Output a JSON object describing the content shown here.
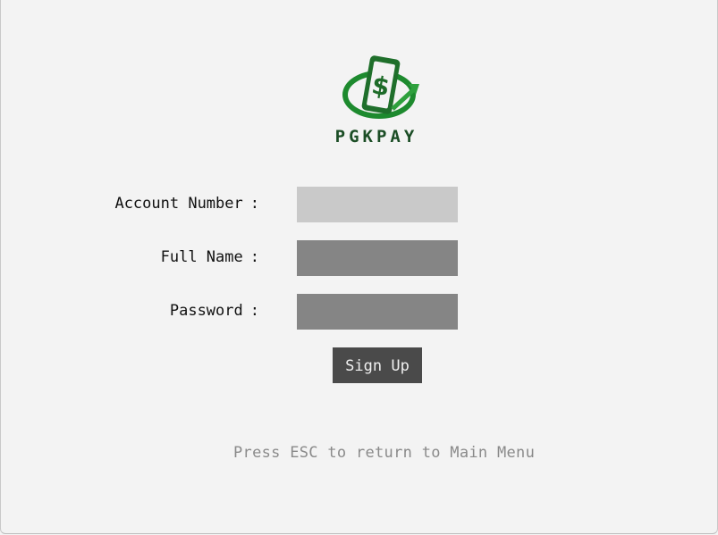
{
  "brand": {
    "name": "PGKPAY",
    "logo_icon": "money-phone-icon",
    "colors": {
      "green": "#1d8a2e",
      "dark_green": "#1b4d25"
    }
  },
  "form": {
    "account_number": {
      "label": "Account Number",
      "colon": ":",
      "value": ""
    },
    "full_name": {
      "label": "Full Name",
      "colon": ":",
      "value": ""
    },
    "password": {
      "label": "Password",
      "colon": ":",
      "value": ""
    }
  },
  "actions": {
    "signup_label": "Sign Up"
  },
  "footer": {
    "hint": "Press ESC to return to Main Menu"
  }
}
